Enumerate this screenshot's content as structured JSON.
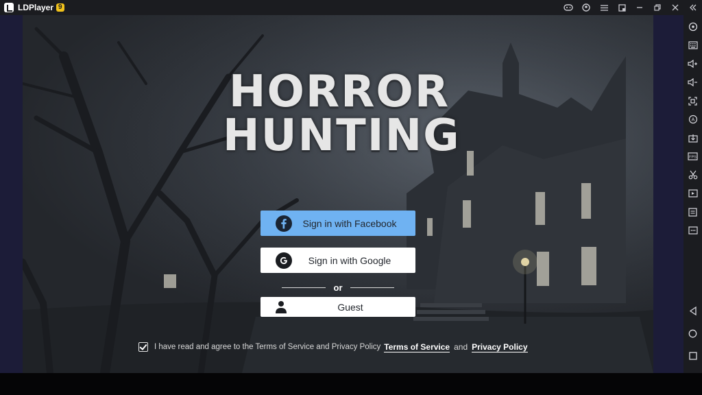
{
  "titlebar": {
    "app_name": "LDPlayer",
    "version": "9",
    "controls": [
      "gamepad-icon",
      "account-icon",
      "menu-icon",
      "screen-record-icon",
      "minimize-icon",
      "restore-icon",
      "close-icon"
    ],
    "collapse_icon": "double-chevron-icon"
  },
  "game": {
    "title_line1": "HORROR",
    "title_line2": "HUNTING",
    "facebook_label": "Sign in with Facebook",
    "google_label": "Sign in with Google",
    "or_label": "or",
    "guest_label": "Guest",
    "terms_text": "I have read and agree to the Terms of Service and Privacy Policy",
    "terms_link": "Terms of Service",
    "and_text": "and",
    "privacy_link": "Privacy Policy",
    "agreed": true
  },
  "sidebar": {
    "icons": [
      "settings-icon",
      "keyboard-icon",
      "volume-up-icon",
      "volume-down-icon",
      "screenshot-icon",
      "sync-icon",
      "install-apk-icon",
      "fps-icon",
      "scissors-icon",
      "video-icon",
      "notes-icon",
      "more-icon",
      "back-icon",
      "home-icon",
      "recent-apps-icon"
    ]
  },
  "colors": {
    "facebook_blue": "#6fb2f2",
    "sidebar_bg": "#1b1c20",
    "letterbox": "#1c1c38",
    "version_badge": "#f1c21b"
  }
}
